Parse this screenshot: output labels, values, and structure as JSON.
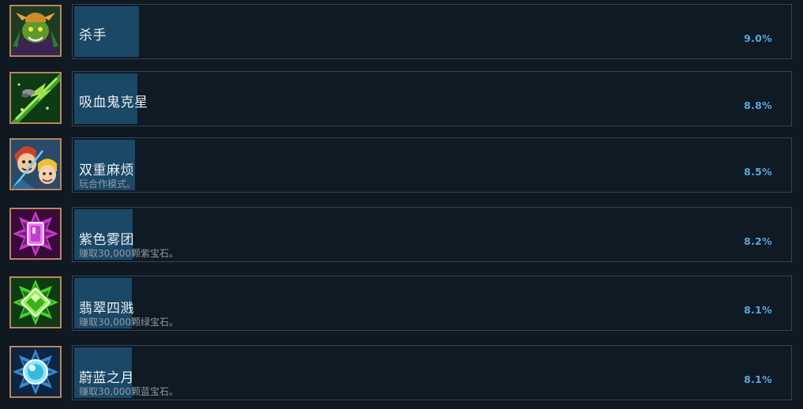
{
  "achievements": [
    {
      "title": "杀手",
      "description": "",
      "percent": "9.0%",
      "fill": 0.09,
      "icon": "green-ogre-icon"
    },
    {
      "title": "吸血鬼克星",
      "description": "",
      "percent": "8.8%",
      "fill": 0.088,
      "icon": "green-bolt-icon"
    },
    {
      "title": "双重麻烦",
      "description": "玩合作模式。",
      "percent": "8.5%",
      "fill": 0.085,
      "icon": "two-heroes-icon"
    },
    {
      "title": "紫色雾团",
      "description": "赚取30,000颗紫宝石。",
      "percent": "8.2%",
      "fill": 0.082,
      "icon": "purple-gem-icon"
    },
    {
      "title": "翡翠四溅",
      "description": "赚取30,000颗绿宝石。",
      "percent": "8.1%",
      "fill": 0.081,
      "icon": "green-gem-icon"
    },
    {
      "title": "蔚蓝之月",
      "description": "赚取30,000颗蓝宝石。",
      "percent": "8.1%",
      "fill": 0.081,
      "icon": "blue-gem-icon"
    }
  ],
  "colors": {
    "background": "#101822",
    "bar": "#1a4866",
    "percent": "#5aa7dc",
    "frame": "#b8865a"
  }
}
